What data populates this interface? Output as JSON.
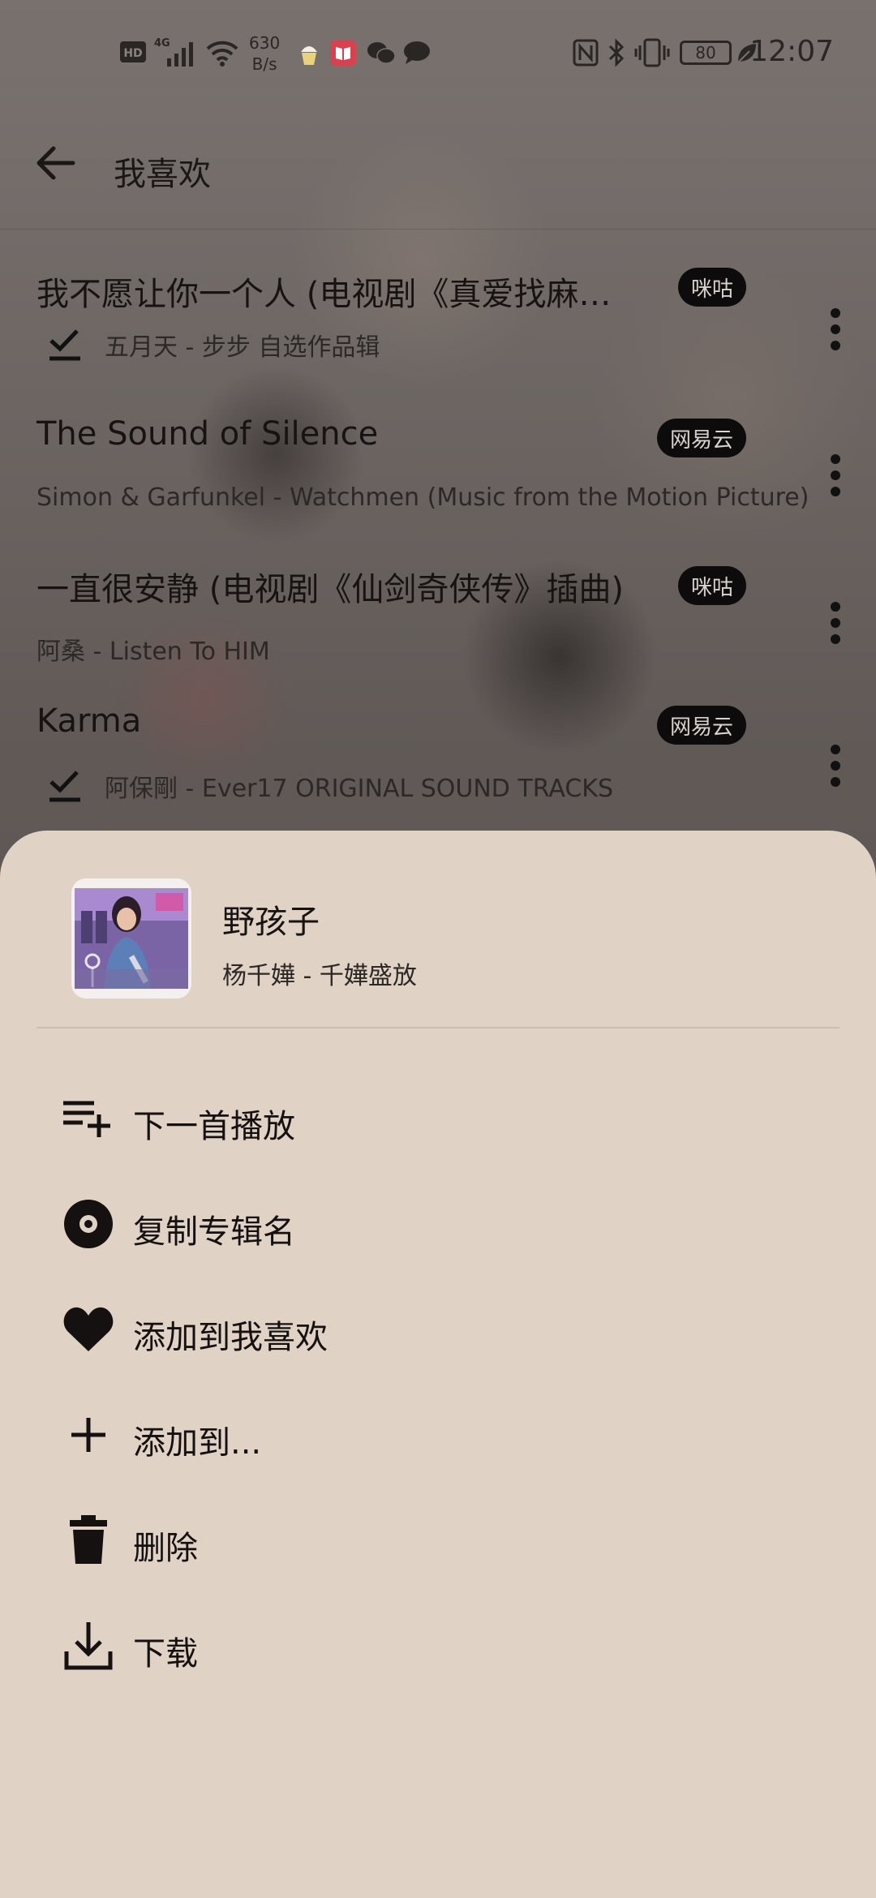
{
  "status_bar": {
    "network_speed_value": "630",
    "network_speed_unit": "B/s",
    "battery": "80",
    "time": "12:07",
    "icons": [
      "hd-icon",
      "4g-signal-icon",
      "wifi-icon",
      "cupcake-app-icon",
      "book-app-icon",
      "wechat-icon",
      "message-icon",
      "nfc-icon",
      "bluetooth-icon",
      "vibrate-icon",
      "battery-icon",
      "leaf-icon"
    ]
  },
  "header": {
    "title": "我喜欢"
  },
  "songs": [
    {
      "title": "我不愿让你一个人 (电视剧《真爱找麻…",
      "subtitle": "五月天 - 步步 自选作品辑",
      "source": "咪咕",
      "downloaded": true
    },
    {
      "title": "The Sound of Silence",
      "subtitle": "Simon & Garfunkel - Watchmen (Music from the Motion Picture)",
      "source": "网易云",
      "downloaded": false
    },
    {
      "title": "一直很安静 (电视剧《仙剑奇侠传》插曲)",
      "subtitle": "阿桑 - Listen To HIM",
      "source": "咪咕",
      "downloaded": false
    },
    {
      "title": "Karma",
      "subtitle": "阿保剛 - Ever17 ORIGINAL SOUND TRACKS",
      "source": "网易云",
      "downloaded": true
    }
  ],
  "sheet": {
    "song_title": "野孩子",
    "song_subtitle": "杨千嬅 - 千嬅盛放",
    "menu": [
      {
        "label": "下一首播放",
        "icon": "play-next-icon"
      },
      {
        "label": "复制专辑名",
        "icon": "album-disc-icon"
      },
      {
        "label": "添加到我喜欢",
        "icon": "heart-icon"
      },
      {
        "label": "添加到...",
        "icon": "plus-icon"
      },
      {
        "label": "删除",
        "icon": "trash-icon"
      },
      {
        "label": "下载",
        "icon": "download-icon"
      }
    ]
  },
  "colors": {
    "sheet_bg": "#e0d2c5",
    "badge_bg": "#0d0b0b",
    "badge_text": "#d9d2cd"
  }
}
